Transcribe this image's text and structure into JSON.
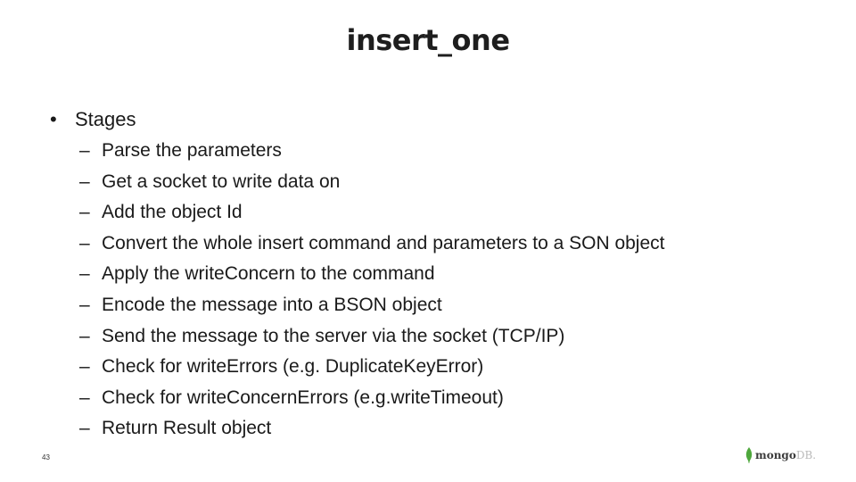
{
  "slide": {
    "title": "insert_one",
    "bullet": {
      "marker": "•",
      "label": "Stages",
      "sub_marker": "–",
      "items": [
        "Parse the parameters",
        "Get a socket to write data on",
        "Add the object Id",
        "Convert the whole insert command and parameters to a SON object",
        "Apply the writeConcern to the command",
        "Encode the message into a BSON object",
        "Send the message to the server via the socket (TCP/IP)",
        "Check for writeErrors (e.g. DuplicateKeyError)",
        "Check for writeConcernErrors (e.g.writeTimeout)",
        "Return Result object"
      ]
    },
    "page_number": "43"
  },
  "logo": {
    "icon": "leaf-icon",
    "text_main": "mongo",
    "text_suffix": "DB.",
    "leaf_color": "#4fa83d"
  }
}
